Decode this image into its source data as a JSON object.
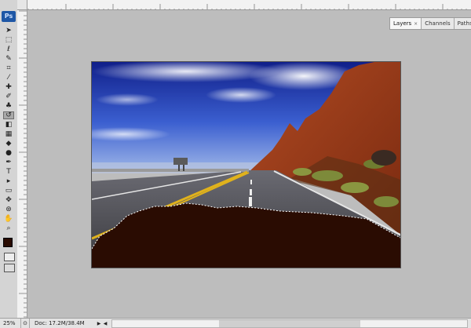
{
  "app": {
    "logo_text": "Ps",
    "accent_color": "#1e57a6"
  },
  "toolbar": {
    "tools": [
      {
        "name": "move-tool",
        "glyph": "➤"
      },
      {
        "name": "marquee-tool",
        "glyph": "⬚"
      },
      {
        "name": "lasso-tool",
        "glyph": "ℓ"
      },
      {
        "name": "quick-select-tool",
        "glyph": "✎"
      },
      {
        "name": "crop-tool",
        "glyph": "⌗"
      },
      {
        "name": "eyedropper-tool",
        "glyph": "⁄"
      },
      {
        "name": "healing-brush-tool",
        "glyph": "✚"
      },
      {
        "name": "brush-tool",
        "glyph": "✐"
      },
      {
        "name": "clone-stamp-tool",
        "glyph": "♣"
      },
      {
        "name": "history-brush-tool",
        "glyph": "↺"
      },
      {
        "name": "eraser-tool",
        "glyph": "◧"
      },
      {
        "name": "gradient-tool",
        "glyph": "▦"
      },
      {
        "name": "blur-tool",
        "glyph": "◆"
      },
      {
        "name": "dodge-tool",
        "glyph": "●"
      },
      {
        "name": "pen-tool",
        "glyph": "✒"
      },
      {
        "name": "type-tool",
        "glyph": "T"
      },
      {
        "name": "path-select-tool",
        "glyph": "▸"
      },
      {
        "name": "shape-tool",
        "glyph": "▭"
      },
      {
        "name": "3d-rotate-tool",
        "glyph": "✥"
      },
      {
        "name": "3d-orbit-tool",
        "glyph": "⊛"
      },
      {
        "name": "hand-tool",
        "glyph": "✋"
      },
      {
        "name": "zoom-tool",
        "glyph": "⌕"
      }
    ],
    "foreground_color": "#2a0c02",
    "background_color": "#ffffff"
  },
  "panels": {
    "tabs": [
      {
        "label": "Layers",
        "close": "×"
      },
      {
        "label": "Channels"
      },
      {
        "label": "Paths"
      }
    ]
  },
  "document": {
    "selection_fill_color": "#2a0c02"
  },
  "status": {
    "zoom": "25%",
    "doc_info": "Doc: 17.2M/38.4M",
    "arrow": "▶",
    "left_arrow": "◀"
  }
}
